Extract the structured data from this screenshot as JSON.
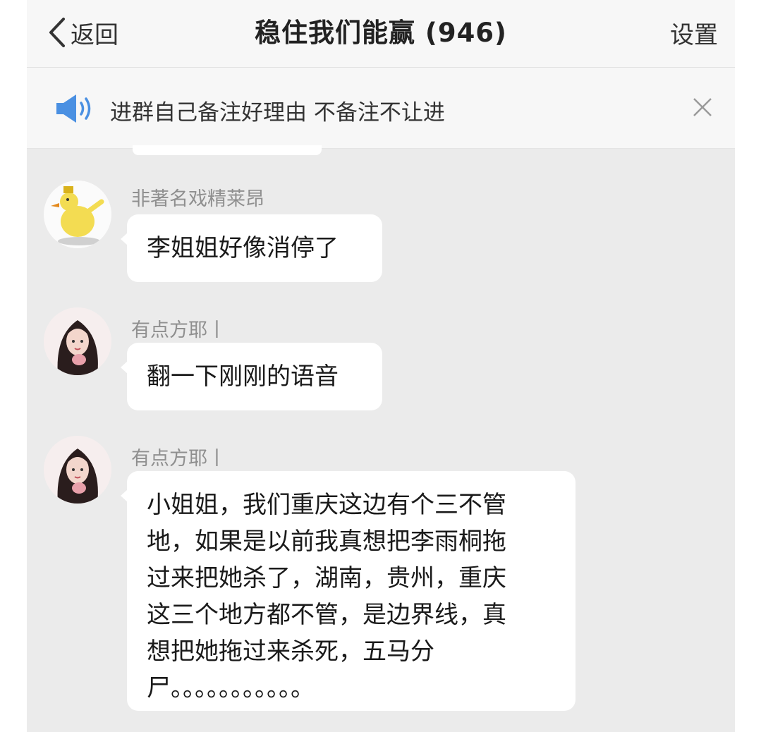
{
  "header": {
    "back_label": "返回",
    "title": "稳住我们能赢 (946)",
    "settings_label": "设置"
  },
  "notice": {
    "text": "进群自己备注好理由 不备注不让进"
  },
  "messages": [
    {
      "sender": "非著名戏精莱昂",
      "text": "李姐姐好像消停了"
    },
    {
      "sender": "有点方耶丨",
      "text": "翻一下刚刚的语音"
    },
    {
      "sender": "有点方耶丨",
      "lines": [
        "小姐姐，我们重庆这边有个三不管",
        "地，如果是以前我真想把李雨桐拖",
        "过来把她杀了，湖南，贵州，重庆",
        "这三个地方都不管，是边界线，真",
        "想把她拖过来杀死，五马分",
        "尸。。。。。。。。。。。"
      ]
    }
  ],
  "colors": {
    "background": "#ebebeb",
    "bubble": "#ffffff",
    "accent": "#4a90e2",
    "sender_text": "#8f8f8f"
  },
  "icons": {
    "back": "chevron-left-icon",
    "notice": "speaker-icon",
    "close": "close-icon"
  }
}
